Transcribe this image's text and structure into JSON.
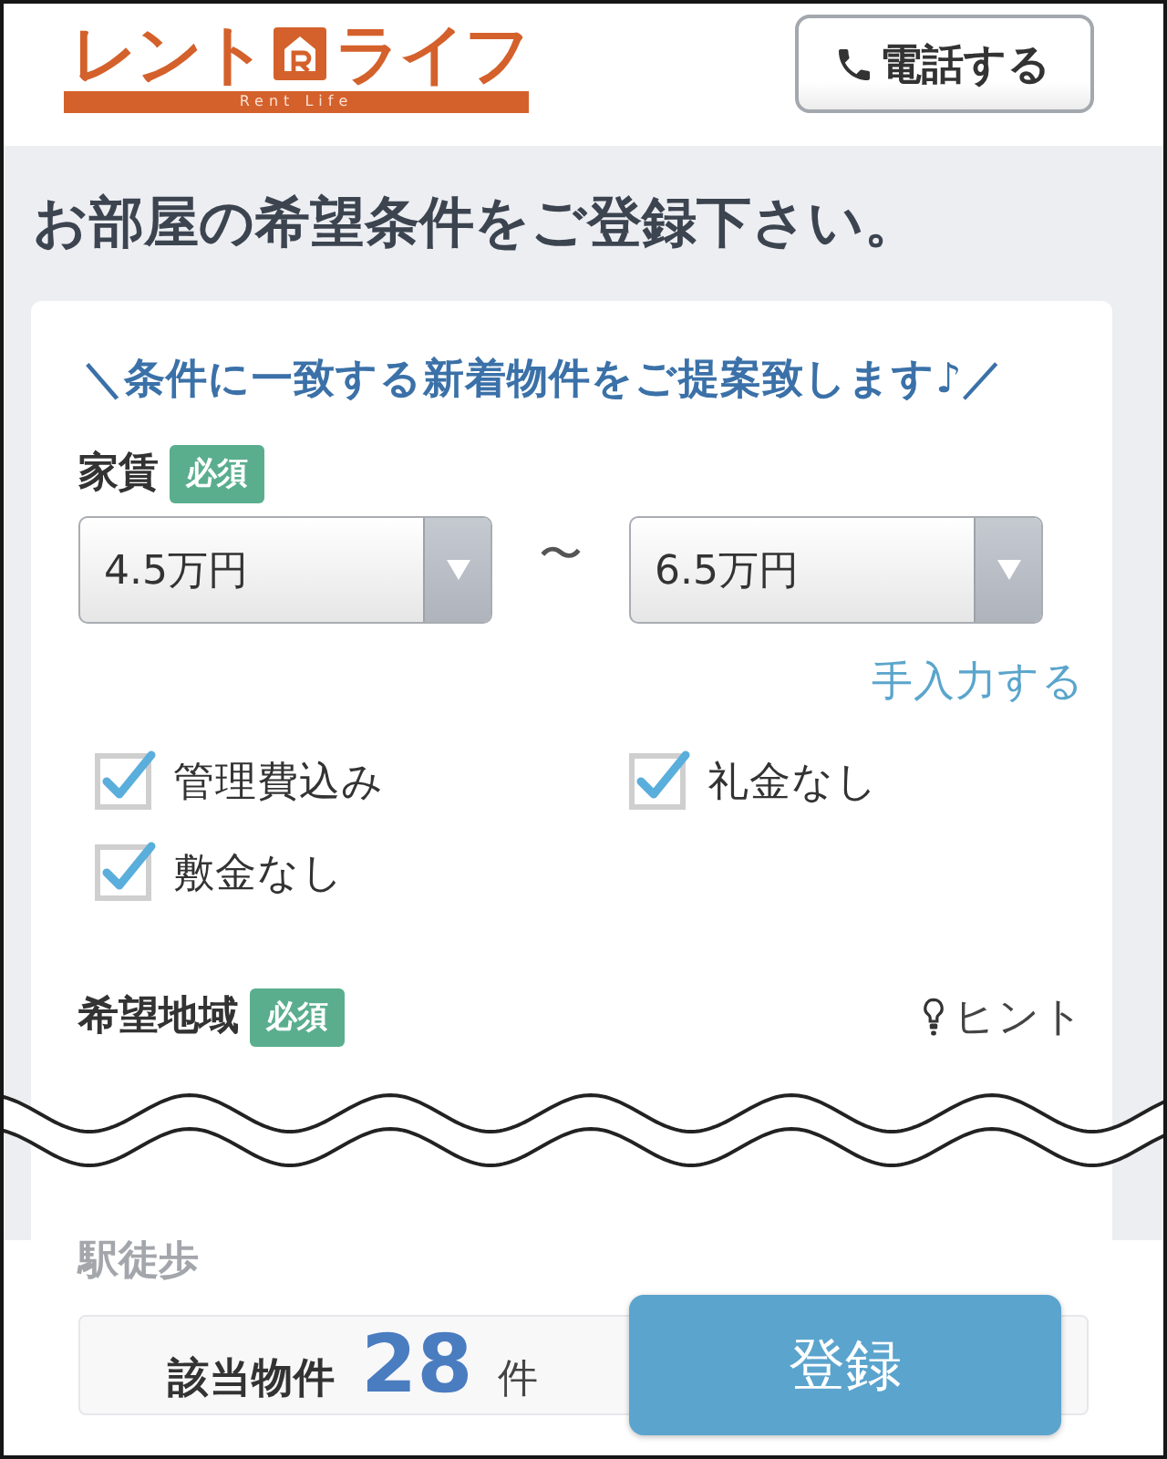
{
  "header": {
    "logo": {
      "left_text": "レント",
      "right_text": "ライフ",
      "tagline": "Rent Life"
    },
    "phone_button": {
      "label": "電話する"
    }
  },
  "page_title": "お部屋の希望条件をご登録下さい。",
  "form": {
    "lead": "＼条件に一致する新着物件をご提案致します♪／",
    "rent": {
      "label": "家賃",
      "badge": "必須",
      "min_select": {
        "value": "4.5万円"
      },
      "separator": "〜",
      "max_select": {
        "value": "6.5万円"
      },
      "manual_input_link": "手入力する",
      "options": [
        {
          "label": "管理費込み",
          "checked": true
        },
        {
          "label": "礼金なし",
          "checked": true
        },
        {
          "label": "敷金なし",
          "checked": true
        }
      ]
    },
    "area": {
      "label": "希望地域",
      "badge": "必須",
      "hint_link": "ヒント"
    },
    "walk": {
      "label": "駅徒歩"
    }
  },
  "footer": {
    "count_label": "該当物件",
    "count": "28",
    "count_unit": "件",
    "submit_button": "登録"
  }
}
